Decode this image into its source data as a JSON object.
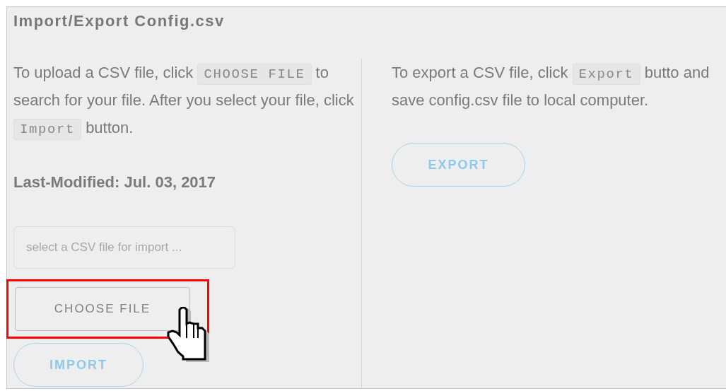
{
  "title": "Import/Export Config.csv",
  "import": {
    "instructions": [
      {
        "kind": "text",
        "text": "To upload a CSV file, click "
      },
      {
        "kind": "code",
        "text": "CHOOSE FILE"
      },
      {
        "kind": "text",
        "text": " to search for your file. After you select your file, click "
      },
      {
        "kind": "code",
        "text": "Import"
      },
      {
        "kind": "text",
        "text": " button."
      }
    ],
    "last_modified": "Last-Modified: Jul. 03, 2017",
    "file_field": {
      "placeholder": "select a CSV file for import ..."
    },
    "choose_button": {
      "label": "CHOOSE FILE",
      "highlighted": true,
      "pointer_over": true
    },
    "import_button": {
      "label": "IMPORT"
    }
  },
  "export": {
    "instructions": [
      {
        "kind": "text",
        "text": "To export a CSV file, click "
      },
      {
        "kind": "code",
        "text": "Export"
      },
      {
        "kind": "text",
        "text": " butto and save config.csv file to local computer."
      }
    ],
    "export_button": {
      "label": "EXPORT"
    }
  }
}
